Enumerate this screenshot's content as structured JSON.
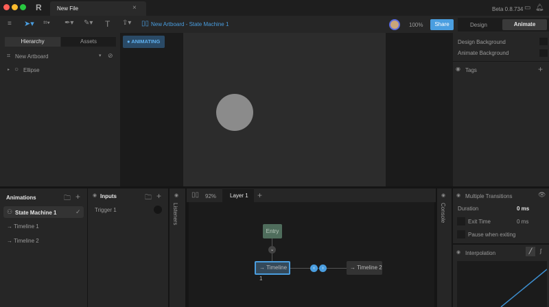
{
  "titlebar": {
    "tab_title": "New File",
    "version": "Beta 0.8.734"
  },
  "toolbar": {
    "breadcrumb": "New Artboard - State Machine 1",
    "zoom": "100%",
    "share": "Share",
    "mode_design": "Design",
    "mode_animate": "Animate"
  },
  "left": {
    "tab_hierarchy": "Hierarchy",
    "tab_assets": "Assets",
    "artboard": "New Artboard",
    "ellipse": "Ellipse"
  },
  "stage": {
    "animating": "ANIMATING"
  },
  "right": {
    "design_bg": "Design Background",
    "animate_bg": "Animate Background",
    "tags": "Tags"
  },
  "animations": {
    "title": "Animations",
    "items": [
      {
        "label": "State Machine 1"
      },
      {
        "label": "Timeline 1"
      },
      {
        "label": "Timeline 2"
      }
    ]
  },
  "inputs": {
    "title": "Inputs",
    "items": [
      {
        "label": "Trigger 1"
      }
    ]
  },
  "graph": {
    "listeners": "Listeners",
    "console": "Console",
    "zoom": "92%",
    "layer_tab": "Layer 1",
    "entry": "Entry",
    "node1": "Timeline 1",
    "node2": "Timeline 2"
  },
  "transition": {
    "title": "Multiple Transitions",
    "duration_label": "Duration",
    "duration_value": "0 ms",
    "exit_label": "Exit Time",
    "exit_value": "0 ms",
    "pause_label": "Pause when exiting",
    "interpolation": "Interpolation"
  },
  "colors": {
    "accent": "#4a9ee0",
    "entry": "#4f6d5c"
  }
}
